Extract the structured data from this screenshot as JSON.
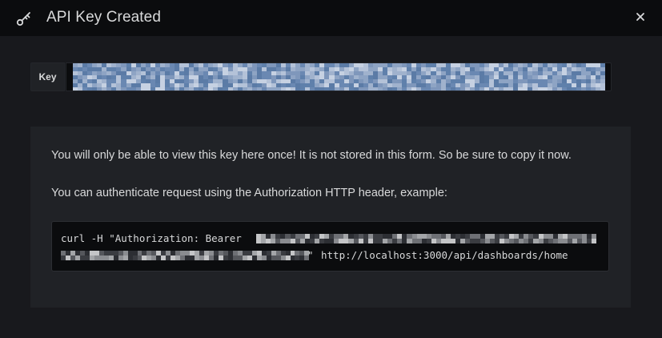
{
  "modal": {
    "title": "API Key Created",
    "icon": "key-icon",
    "close_icon": "close-icon"
  },
  "key_field": {
    "label": "Key",
    "value": "",
    "selection_color": "#5b7ba6"
  },
  "info": {
    "line1": "You will only be able to view this key here once! It is not stored in this form. So be sure to copy it now.",
    "line2": "You can authenticate request using the Authorization HTTP header, example:",
    "code_prefix": "curl -H \"Authorization: Bearer ",
    "code_quote": "\"",
    "code_suffix": " http://localhost:3000/api/dashboards/home"
  },
  "colors": {
    "background": "#18191d",
    "header": "#0b0c0e",
    "panel": "#202226",
    "text": "#d8d9da"
  }
}
